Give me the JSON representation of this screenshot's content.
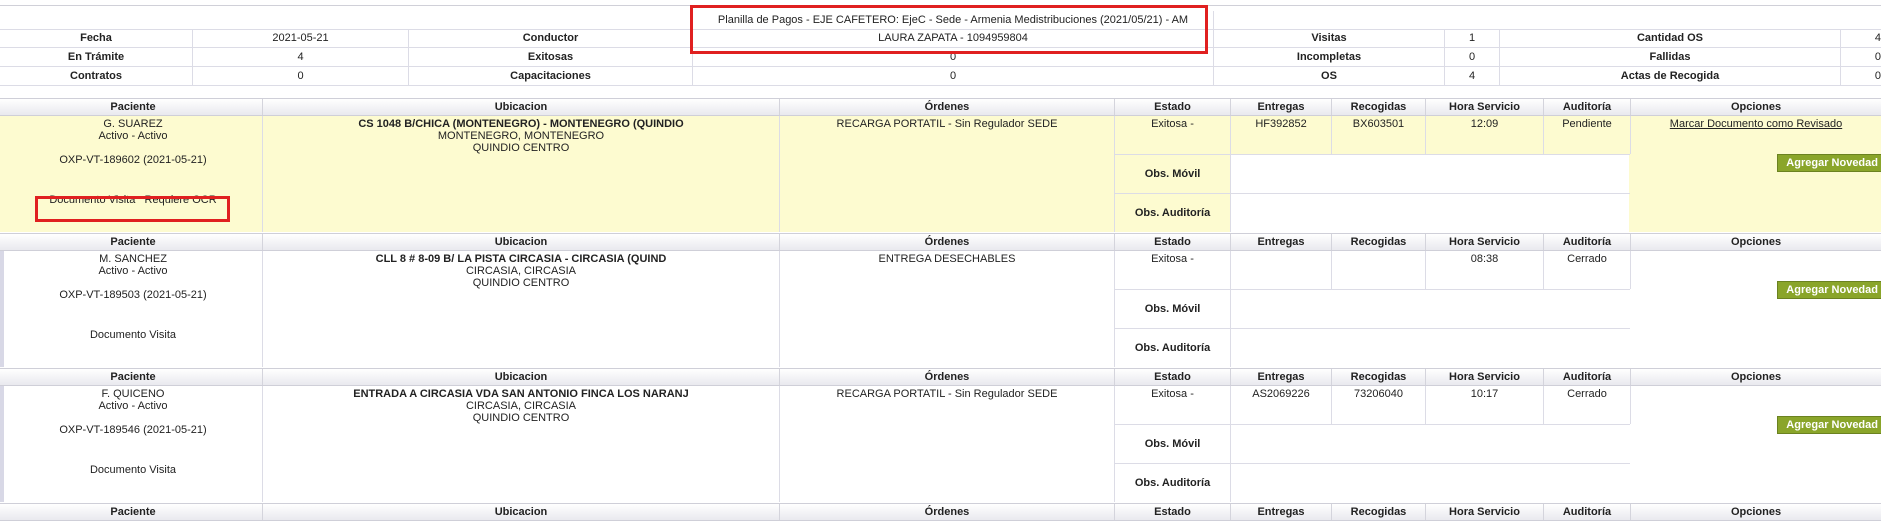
{
  "planilla": {
    "title": "Planilla de Pagos - EJE CAFETERO: EjeC - Sede - Armenia Medistribuciones (2021/05/21) - AM",
    "driver": "LAURA ZAPATA - 1094959804"
  },
  "summary": {
    "fecha_label": "Fecha",
    "fecha": "2021-05-21",
    "conductor_label": "Conductor",
    "visitas_label": "Visitas",
    "visitas": "1",
    "cantidad_os_label": "Cantidad OS",
    "cantidad_os": "4",
    "tramite_label": "En Trámite",
    "tramite": "4",
    "exitosas_label": "Exitosas",
    "exitosas": "0",
    "incompletas_label": "Incompletas",
    "incompletas": "0",
    "fallidas_label": "Fallidas",
    "fallidas": "0",
    "contratos_label": "Contratos",
    "contratos": "0",
    "capacitaciones_label": "Capacitaciones",
    "capacitaciones": "0",
    "os_label": "OS",
    "os": "4",
    "actas_label": "Actas de Recogida",
    "actas": "0"
  },
  "headers": {
    "paciente": "Paciente",
    "ubicacion": "Ubicacion",
    "ordenes": "Órdenes",
    "estado": "Estado",
    "entregas": "Entregas",
    "recogidas": "Recogidas",
    "hora": "Hora Servicio",
    "auditoria": "Auditoría",
    "opciones": "Opciones"
  },
  "sublabels": {
    "obs_movil": "Obs. Móvil",
    "obs_auditoria": "Obs. Auditoría"
  },
  "buttons": {
    "agregar_novedad": "Agregar Novedad"
  },
  "records": [
    {
      "name": "G. SUAREZ",
      "status": "Activo - Activo",
      "code": "OXP-VT-189602 (2021-05-21)",
      "doc": "Documento Visita",
      "ocr": "Requiere OCR",
      "addr": "CS 1048 B/CHICA (MONTENEGRO) - MONTENEGRO (QUINDIO",
      "city": "MONTENEGRO, MONTENEGRO",
      "region": "QUINDIO CENTRO",
      "orden": "RECARGA PORTATIL - Sin Regulador SEDE",
      "estado": "Exitosa -",
      "entregas": "HF392852",
      "recogidas": "BX603501",
      "hora": "12:09",
      "auditoria": "Pendiente",
      "opcion": "Marcar Documento como Revisado"
    },
    {
      "name": "M. SANCHEZ",
      "status": "Activo - Activo",
      "code": "OXP-VT-189503 (2021-05-21)",
      "doc": "Documento Visita",
      "addr": "CLL 8 # 8-09 B/ LA PISTA CIRCASIA - CIRCASIA (QUIND",
      "city": "CIRCASIA, CIRCASIA",
      "region": "QUINDIO CENTRO",
      "orden": "ENTREGA DESECHABLES",
      "estado": "Exitosa -",
      "entregas": "",
      "recogidas": "",
      "hora": "08:38",
      "auditoria": "Cerrado"
    },
    {
      "name": "F. QUICENO",
      "status": "Activo - Activo",
      "code": "OXP-VT-189546 (2021-05-21)",
      "doc": "Documento Visita",
      "addr": "ENTRADA A CIRCASIA VDA SAN ANTONIO FINCA LOS NARANJ",
      "city": "CIRCASIA, CIRCASIA",
      "region": "QUINDIO CENTRO",
      "orden": "RECARGA PORTATIL - Sin Regulador SEDE",
      "estado": "Exitosa -",
      "entregas": "AS2069226",
      "recogidas": "73206040",
      "hora": "10:17",
      "auditoria": "Cerrado"
    }
  ]
}
